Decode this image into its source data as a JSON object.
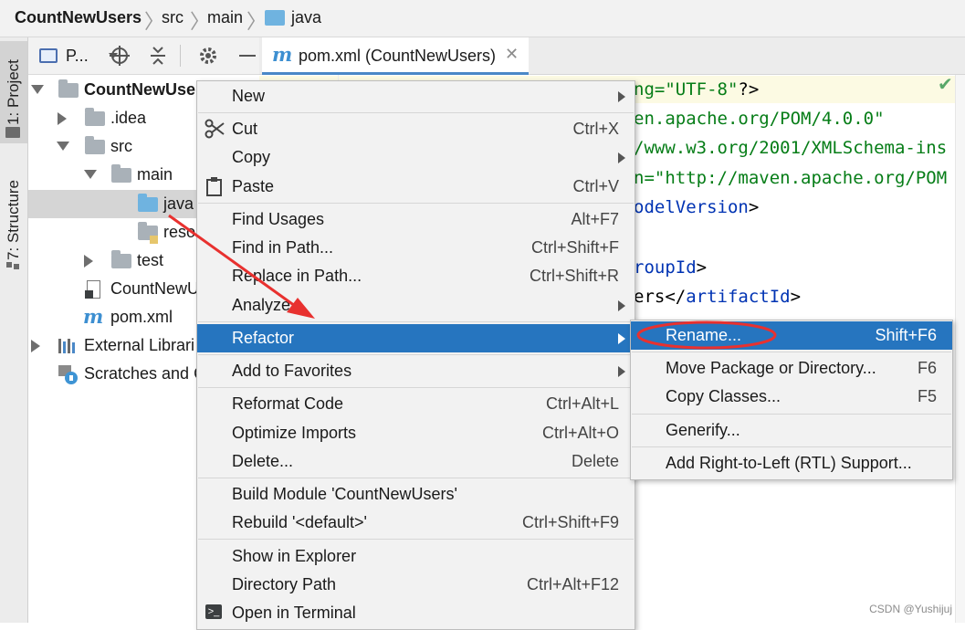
{
  "breadcrumb": {
    "items": [
      "CountNewUsers",
      "src",
      "main",
      "java"
    ]
  },
  "side_tabs": {
    "project": "1: Project",
    "structure": "7: Structure"
  },
  "project_toolbar": {
    "view_label": "P..."
  },
  "editor_tab": {
    "title": "pom.xml (CountNewUsers)"
  },
  "tree": {
    "root": "CountNewUser",
    "idea": ".idea",
    "src": "src",
    "main": "main",
    "java": "java",
    "resources": "reso",
    "test": "test",
    "iml": "CountNewU",
    "pom": "pom.xml",
    "external": "External Librari",
    "scratches": "Scratches and C"
  },
  "code": {
    "l1_str": "ng=\"UTF-8\"",
    "l1_end": "?>",
    "l2": "en.apache.org/POM/4.0.0\"",
    "l3": "/www.w3.org/2001/XMLSchema-ins",
    "l4_a": "n=",
    "l4_b": "\"http://maven.apache.org/POM",
    "l5": "odelVersion",
    "l5_end": ">",
    "l7": "roupId",
    "l7_end": ">",
    "l8_a": "ers</",
    "l8_b": "artifactId",
    "l8_c": ">"
  },
  "context_menu": {
    "new": "New",
    "cut": "Cut",
    "cut_sc": "Ctrl+X",
    "copy": "Copy",
    "paste": "Paste",
    "paste_sc": "Ctrl+V",
    "find_usages": "Find Usages",
    "find_usages_sc": "Alt+F7",
    "find_in_path": "Find in Path...",
    "find_in_path_sc": "Ctrl+Shift+F",
    "replace_in_path": "Replace in Path...",
    "replace_in_path_sc": "Ctrl+Shift+R",
    "analyze": "Analyze",
    "refactor": "Refactor",
    "add_favorites": "Add to Favorites",
    "reformat": "Reformat Code",
    "reformat_sc": "Ctrl+Alt+L",
    "optimize": "Optimize Imports",
    "optimize_sc": "Ctrl+Alt+O",
    "delete": "Delete...",
    "delete_sc": "Delete",
    "build_module": "Build Module 'CountNewUsers'",
    "rebuild": "Rebuild '<default>'",
    "rebuild_sc": "Ctrl+Shift+F9",
    "show_explorer": "Show in Explorer",
    "directory_path": "Directory Path",
    "directory_path_sc": "Ctrl+Alt+F12",
    "open_terminal": "Open in Terminal"
  },
  "refactor_submenu": {
    "rename": "Rename...",
    "rename_sc": "Shift+F6",
    "move": "Move Package or Directory...",
    "move_sc": "F6",
    "copy_classes": "Copy Classes...",
    "copy_classes_sc": "F5",
    "generify": "Generify...",
    "rtl": "Add Right-to-Left (RTL) Support..."
  },
  "watermark": "CSDN @Yushijuj",
  "colors": {
    "selection": "#2675bf",
    "annotation_red": "#e8312f",
    "string_green": "#067d17",
    "tag_blue": "#0033b3"
  }
}
